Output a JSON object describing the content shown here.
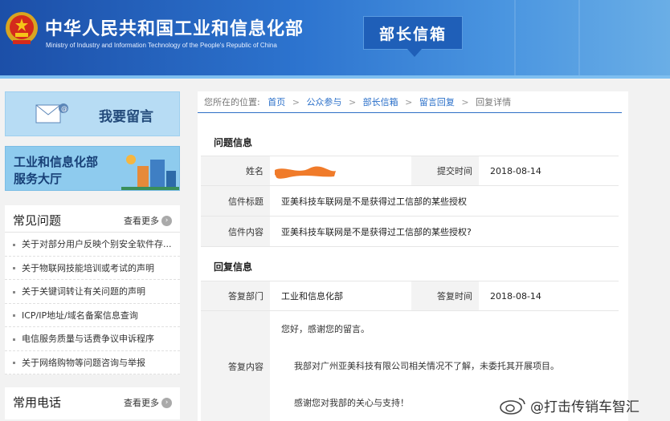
{
  "header": {
    "title_cn": "中华人民共和国工业和信息化部",
    "title_en": "Ministry of Industry and Information Technology of the People's Republic of China",
    "section_badge": "部长信箱"
  },
  "sidebar": {
    "leave_message_banner": "我要留言",
    "service_hall_line1": "工业和信息化部",
    "service_hall_line2": "服务大厅",
    "faq": {
      "title": "常见问题",
      "more": "查看更多",
      "items": [
        "关于对部分用户反映个别安全软件存...",
        "关于物联网技能培训或考试的声明",
        "关于关键词转让有关问题的声明",
        "ICP/IP地址/域名备案信息查询",
        "电信服务质量与话费争议申诉程序",
        "关于网络购物等问题咨询与举报"
      ]
    },
    "phone": {
      "title": "常用电话",
      "more": "查看更多"
    }
  },
  "breadcrumb": {
    "prefix": "您所在的位置:",
    "items": [
      "首页",
      "公众参与",
      "部长信箱",
      "留言回复",
      "回复详情"
    ]
  },
  "question": {
    "section_title": "问题信息",
    "name_label": "姓名",
    "submit_time_label": "提交时间",
    "submit_time": "2018-08-14",
    "subject_label": "信件标题",
    "subject": "亚美科技车联网是不是获得过工信部的某些授权",
    "content_label": "信件内容",
    "content": "亚美科技车联网是不是获得过工信部的某些授权?"
  },
  "reply": {
    "section_title": "回复信息",
    "dept_label": "答复部门",
    "dept": "工业和信息化部",
    "time_label": "答复时间",
    "time": "2018-08-14",
    "content_label": "答复内容",
    "line1": "您好，感谢您的留言。",
    "line2": "我部对广州亚美科技有限公司相关情况不了解，未委托其开展项目。",
    "line3": "感谢您对我部的关心与支持！"
  },
  "watermark": "@打击传销车智汇",
  "colors": {
    "header_blue": "#1c4fa8",
    "link_blue": "#2a6fc9",
    "redaction_orange": "#f07b2a"
  }
}
